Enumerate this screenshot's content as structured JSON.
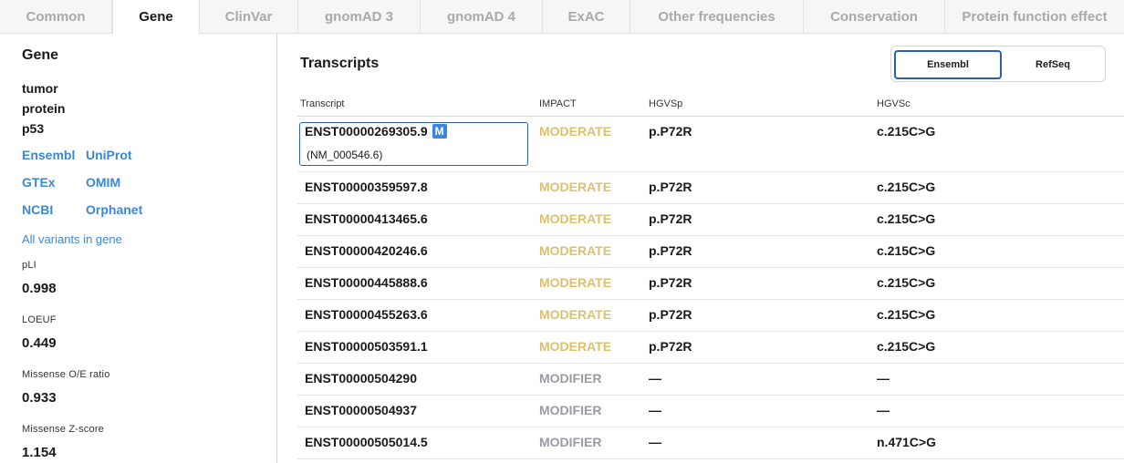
{
  "tabs": [
    {
      "label": "Common",
      "active": false
    },
    {
      "label": "Gene",
      "active": true
    },
    {
      "label": "ClinVar",
      "active": false
    },
    {
      "label": "gnomAD 3",
      "active": false
    },
    {
      "label": "gnomAD 4",
      "active": false
    },
    {
      "label": "ExAC",
      "active": false
    },
    {
      "label": "Other frequencies",
      "active": false
    },
    {
      "label": "Conservation",
      "active": false
    },
    {
      "label": "Protein function effect",
      "active": false
    }
  ],
  "sidebar": {
    "heading": "Gene",
    "gene_name_lines": [
      "tumor",
      "protein",
      "p53"
    ],
    "links": [
      "Ensembl",
      "UniProt",
      "GTEx",
      "OMIM",
      "NCBI",
      "Orphanet"
    ],
    "all_variants_link": "All variants in gene",
    "metrics": [
      {
        "label": "pLI",
        "value": "0.998"
      },
      {
        "label": "LOEUF",
        "value": "0.449"
      },
      {
        "label": "Missense O/E ratio",
        "value": "0.933"
      },
      {
        "label": "Missense Z-score",
        "value": "1.154"
      }
    ]
  },
  "main": {
    "title": "Transcripts",
    "source_toggle": {
      "options": [
        "Ensembl",
        "RefSeq"
      ],
      "selected": "Ensembl"
    },
    "columns": [
      "Transcript",
      "IMPACT",
      "HGVSp",
      "HGVSc"
    ],
    "rows": [
      {
        "transcript": "ENST00000269305.9",
        "badge": "M",
        "refseq": "(NM_000546.6)",
        "impact": "MODERATE",
        "hgvsp": "p.P72R",
        "hgvsc": "c.215C>G",
        "selected": true
      },
      {
        "transcript": "ENST00000359597.8",
        "impact": "MODERATE",
        "hgvsp": "p.P72R",
        "hgvsc": "c.215C>G"
      },
      {
        "transcript": "ENST00000413465.6",
        "impact": "MODERATE",
        "hgvsp": "p.P72R",
        "hgvsc": "c.215C>G"
      },
      {
        "transcript": "ENST00000420246.6",
        "impact": "MODERATE",
        "hgvsp": "p.P72R",
        "hgvsc": "c.215C>G"
      },
      {
        "transcript": "ENST00000445888.6",
        "impact": "MODERATE",
        "hgvsp": "p.P72R",
        "hgvsc": "c.215C>G"
      },
      {
        "transcript": "ENST00000455263.6",
        "impact": "MODERATE",
        "hgvsp": "p.P72R",
        "hgvsc": "c.215C>G"
      },
      {
        "transcript": "ENST00000503591.1",
        "impact": "MODERATE",
        "hgvsp": "p.P72R",
        "hgvsc": "c.215C>G"
      },
      {
        "transcript": "ENST00000504290",
        "impact": "MODIFIER",
        "hgvsp": "—",
        "hgvsc": "—"
      },
      {
        "transcript": "ENST00000504937",
        "impact": "MODIFIER",
        "hgvsp": "—",
        "hgvsc": "—"
      },
      {
        "transcript": "ENST00000505014.5",
        "impact": "MODIFIER",
        "hgvsp": "—",
        "hgvsc": "n.471C>G"
      }
    ]
  },
  "colors": {
    "link": "#3a87dc",
    "moderate": "#dcc06f",
    "modifier": "#9a9aa6",
    "selected_border": "#2d5fb1"
  }
}
